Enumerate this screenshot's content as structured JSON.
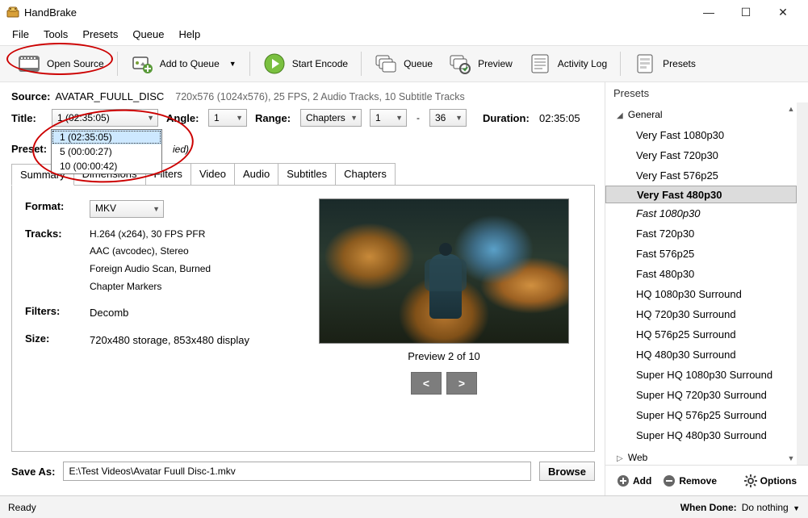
{
  "app": {
    "title": "HandBrake"
  },
  "menu": {
    "file": "File",
    "tools": "Tools",
    "presets": "Presets",
    "queue": "Queue",
    "help": "Help"
  },
  "toolbar": {
    "open_source": "Open Source",
    "add_to_queue": "Add to Queue",
    "start_encode": "Start Encode",
    "queue": "Queue",
    "preview": "Preview",
    "activity_log": "Activity Log",
    "presets": "Presets"
  },
  "source": {
    "label": "Source:",
    "name": "AVATAR_FUULL_DISC",
    "info": "720x576 (1024x576), 25 FPS, 2 Audio Tracks, 10 Subtitle Tracks"
  },
  "title": {
    "label": "Title:",
    "selected": "1  (02:35:05)",
    "options": [
      "1  (02:35:05)",
      "5  (00:00:27)",
      "10  (00:00:42)"
    ]
  },
  "angle": {
    "label": "Angle:",
    "value": "1"
  },
  "range": {
    "label": "Range:",
    "type": "Chapters",
    "from": "1",
    "sep": "-",
    "to": "36"
  },
  "duration": {
    "label": "Duration:",
    "value": "02:35:05"
  },
  "preset": {
    "label": "Preset:",
    "suffix": "ied)"
  },
  "tabs": {
    "summary": "Summary",
    "dimensions": "Dimensions",
    "filters": "Filters",
    "video": "Video",
    "audio": "Audio",
    "subtitles": "Subtitles",
    "chapters": "Chapters"
  },
  "summary": {
    "format_label": "Format:",
    "format_value": "MKV",
    "tracks_label": "Tracks:",
    "tracks_lines": [
      "H.264 (x264), 30 FPS PFR",
      "AAC (avcodec), Stereo",
      "Foreign Audio Scan, Burned",
      "Chapter Markers"
    ],
    "filters_label": "Filters:",
    "filters_value": "Decomb",
    "size_label": "Size:",
    "size_value": "720x480 storage, 853x480 display",
    "preview_caption": "Preview 2 of 10",
    "prev": "<",
    "next": ">"
  },
  "saveas": {
    "label": "Save As:",
    "path": "E:\\Test Videos\\Avatar Fuull Disc-1.mkv",
    "browse": "Browse"
  },
  "presets_panel": {
    "header": "Presets",
    "general": "General",
    "web": "Web",
    "items": [
      {
        "label": "Very Fast 1080p30"
      },
      {
        "label": "Very Fast 720p30"
      },
      {
        "label": "Very Fast 576p25"
      },
      {
        "label": "Very Fast 480p30",
        "sel": true
      },
      {
        "label": "Fast 1080p30",
        "ital": true
      },
      {
        "label": "Fast 720p30"
      },
      {
        "label": "Fast 576p25"
      },
      {
        "label": "Fast 480p30"
      },
      {
        "label": "HQ 1080p30 Surround"
      },
      {
        "label": "HQ 720p30 Surround"
      },
      {
        "label": "HQ 576p25 Surround"
      },
      {
        "label": "HQ 480p30 Surround"
      },
      {
        "label": "Super HQ 1080p30 Surround"
      },
      {
        "label": "Super HQ 720p30 Surround"
      },
      {
        "label": "Super HQ 576p25 Surround"
      },
      {
        "label": "Super HQ 480p30 Surround"
      }
    ],
    "add": "Add",
    "remove": "Remove",
    "options": "Options"
  },
  "status": {
    "ready": "Ready",
    "when_done": "When Done:",
    "action": "Do nothing"
  }
}
